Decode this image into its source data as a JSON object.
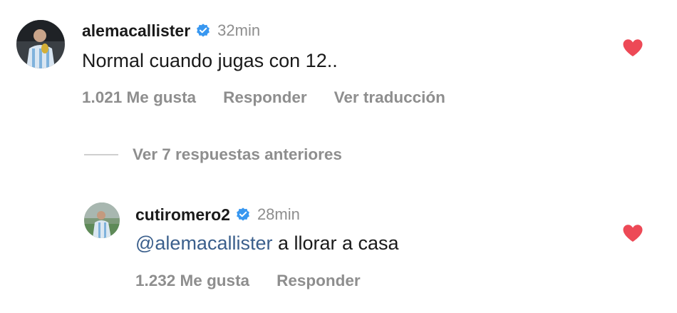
{
  "comments": [
    {
      "username": "alemacallister",
      "verified": true,
      "timestamp": "32min",
      "text": "Normal cuando jugas con 12..",
      "likes_label": "1.021 Me gusta",
      "reply_label": "Responder",
      "translate_label": "Ver traducción",
      "liked": true,
      "avatar_icon": "user-avatar-photo"
    }
  ],
  "view_replies_label": "Ver 7 respuestas anteriores",
  "replies": [
    {
      "username": "cutiromero2",
      "verified": true,
      "timestamp": "28min",
      "mention": "@alemacallister",
      "text": " a llorar a casa",
      "likes_label": "1.232 Me gusta",
      "reply_label": "Responder",
      "liked": true,
      "avatar_icon": "user-avatar-photo"
    }
  ],
  "colors": {
    "heart": "#ed4956",
    "verified": "#3897f0",
    "muted": "#8e8e8e",
    "mention": "#3b5f8c"
  }
}
